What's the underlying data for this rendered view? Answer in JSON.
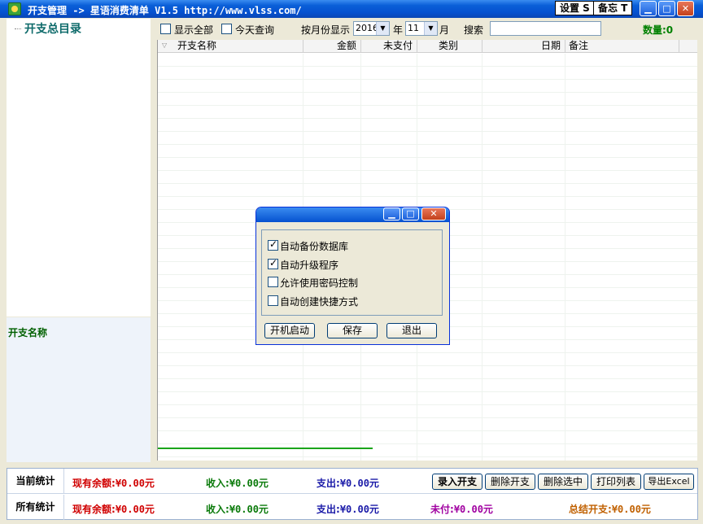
{
  "window": {
    "title": "开支管理 -> 星语消费清单 V1.5 http://www.vlss.com/",
    "settings_btn": "设置 S",
    "memo_btn": "备忘 T"
  },
  "tree": {
    "root_label": "开支总目录",
    "detail_label": "开支名称"
  },
  "toolbar": {
    "show_all": "显示全部",
    "show_all_checked": false,
    "today_query": "今天查询",
    "today_checked": false,
    "month_display_label": "按月份显示",
    "year_value": "2016",
    "year_label": "年",
    "month_value": "11",
    "month_label": "月",
    "search_label": "搜索",
    "search_value": "",
    "count_label": "数量:0"
  },
  "grid": {
    "columns": [
      "开支名称",
      "金额",
      "未支付",
      "类别",
      "日期",
      "备注"
    ]
  },
  "footer": {
    "current_label": "当前统计",
    "all_label": "所有统计",
    "current_balance_label": "现有余额:",
    "current_balance_value": "¥0.00元",
    "income_label": "收入:",
    "income_value": "¥0.00元",
    "expense_label": "支出:",
    "expense_value": "¥0.00元",
    "all_balance_label": "现有余额:",
    "all_balance_value": "¥0.00元",
    "all_income_label": "收入:",
    "all_income_value": "¥0.00元",
    "all_expense_label": "支出:",
    "all_expense_value": "¥0.00元",
    "unpaid_label": "未付:",
    "unpaid_value": "¥0.00元",
    "total_label": "总结开支:",
    "total_value": "¥0.00元",
    "buttons": {
      "add": "录入开支",
      "delete": "删除开支",
      "delete_selected": "删除选中",
      "print": "打印列表",
      "export": "导出Excel"
    }
  },
  "dialog": {
    "options": [
      {
        "label": "自动备份数据库",
        "checked": true
      },
      {
        "label": "自动升级程序",
        "checked": true
      },
      {
        "label": "允许使用密码控制",
        "checked": false
      },
      {
        "label": "自动创建快捷方式",
        "checked": false
      }
    ],
    "startup_btn": "开机启动",
    "save_btn": "保存",
    "exit_btn": "退出"
  }
}
